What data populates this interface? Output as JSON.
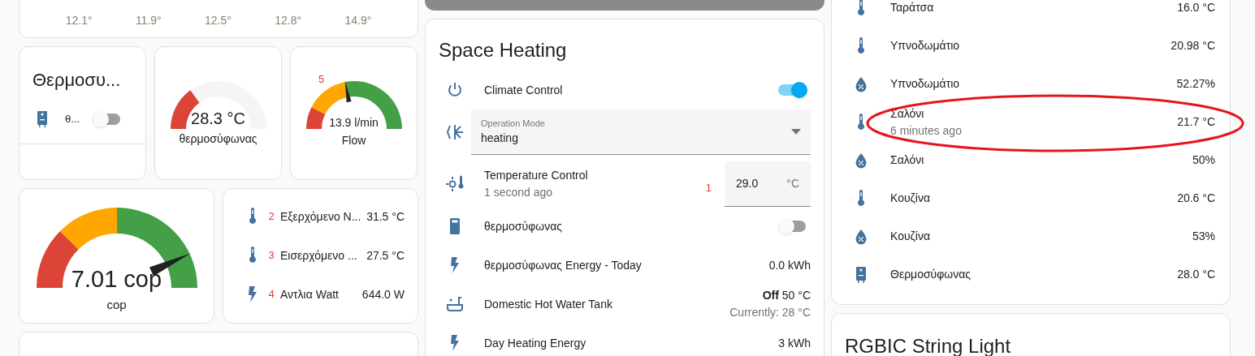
{
  "weather": {
    "lows": [
      "12.1°",
      "11.9°",
      "12.5°",
      "12.8°",
      "14.9°"
    ]
  },
  "water_heater_card": {
    "title": "Θερμοσυ...",
    "entity": {
      "label": "θ...",
      "on": false
    }
  },
  "gauges": [
    {
      "kind": "single",
      "value": "28.3 °C",
      "label": "θερμοσύφωνας",
      "level": 0.3
    },
    {
      "kind": "needle",
      "value": "13.9 l/min",
      "label": "Flow",
      "level": 0.44,
      "marker": "5"
    }
  ],
  "cop_gauge": {
    "value": "7.01 cop",
    "label": "cop",
    "level": 0.86
  },
  "sensor_card": {
    "rows": [
      {
        "kind": "temperature",
        "marker": "2",
        "name": "Εξερχόμενο Ν...",
        "value": "31.5 °C"
      },
      {
        "kind": "temperature",
        "marker": "3",
        "name": "Εισερχόμενο ...",
        "value": "27.5 °C"
      },
      {
        "kind": "power",
        "marker": "4",
        "name": "Αντλια Watt",
        "value": "644.0 W"
      }
    ]
  },
  "space_heating": {
    "title": "Space Heating",
    "rows": [
      {
        "kind": "toggle",
        "name": "Climate Control",
        "on": true
      },
      {
        "kind": "select",
        "label": "Operation Mode",
        "value": "heating"
      },
      {
        "kind": "number",
        "name": "Temperature Control",
        "secondary": "1 second ago",
        "marker": "1",
        "value": "29.0",
        "unit": "°C"
      },
      {
        "kind": "toggle",
        "name": "θερμοσύφωνας",
        "on": false
      },
      {
        "kind": "value",
        "name": "θερμοσύφωνας Energy - Today",
        "value": "0.0 kWh"
      },
      {
        "kind": "value",
        "name": "Domestic Hot Water Tank",
        "value": "**Off** 50 °C",
        "secondary_value": "Currently: 28 °C"
      },
      {
        "kind": "value",
        "name": "Day Heating Energy",
        "value": "3 kWh"
      }
    ]
  },
  "sensors": {
    "rows": [
      {
        "kind": "temperature",
        "name": "Ταράτσα",
        "value": "16.0 °C",
        "highlighted": false
      },
      {
        "kind": "temperature",
        "name": "Υπνοδωμάτιο",
        "value": "20.98 °C",
        "highlighted": false
      },
      {
        "kind": "humidity",
        "name": "Υπνοδωμάτιο",
        "value": "52.27%",
        "highlighted": false
      },
      {
        "kind": "temperature",
        "name": "Σαλόνι",
        "secondary": "6 minutes ago",
        "value": "21.7 °C",
        "highlighted": true
      },
      {
        "kind": "humidity",
        "name": "Σαλόνι",
        "value": "50%",
        "highlighted": false
      },
      {
        "kind": "temperature",
        "name": "Κουζίνα",
        "value": "20.6 °C",
        "highlighted": false
      },
      {
        "kind": "humidity",
        "name": "Κουζίνα",
        "value": "53%",
        "highlighted": false
      },
      {
        "kind": "water-heater",
        "name": "Θερμοσύφωνας",
        "value": "28.0 °C",
        "highlighted": false
      }
    ]
  },
  "light_card": {
    "title": "RGBIC String Light"
  }
}
